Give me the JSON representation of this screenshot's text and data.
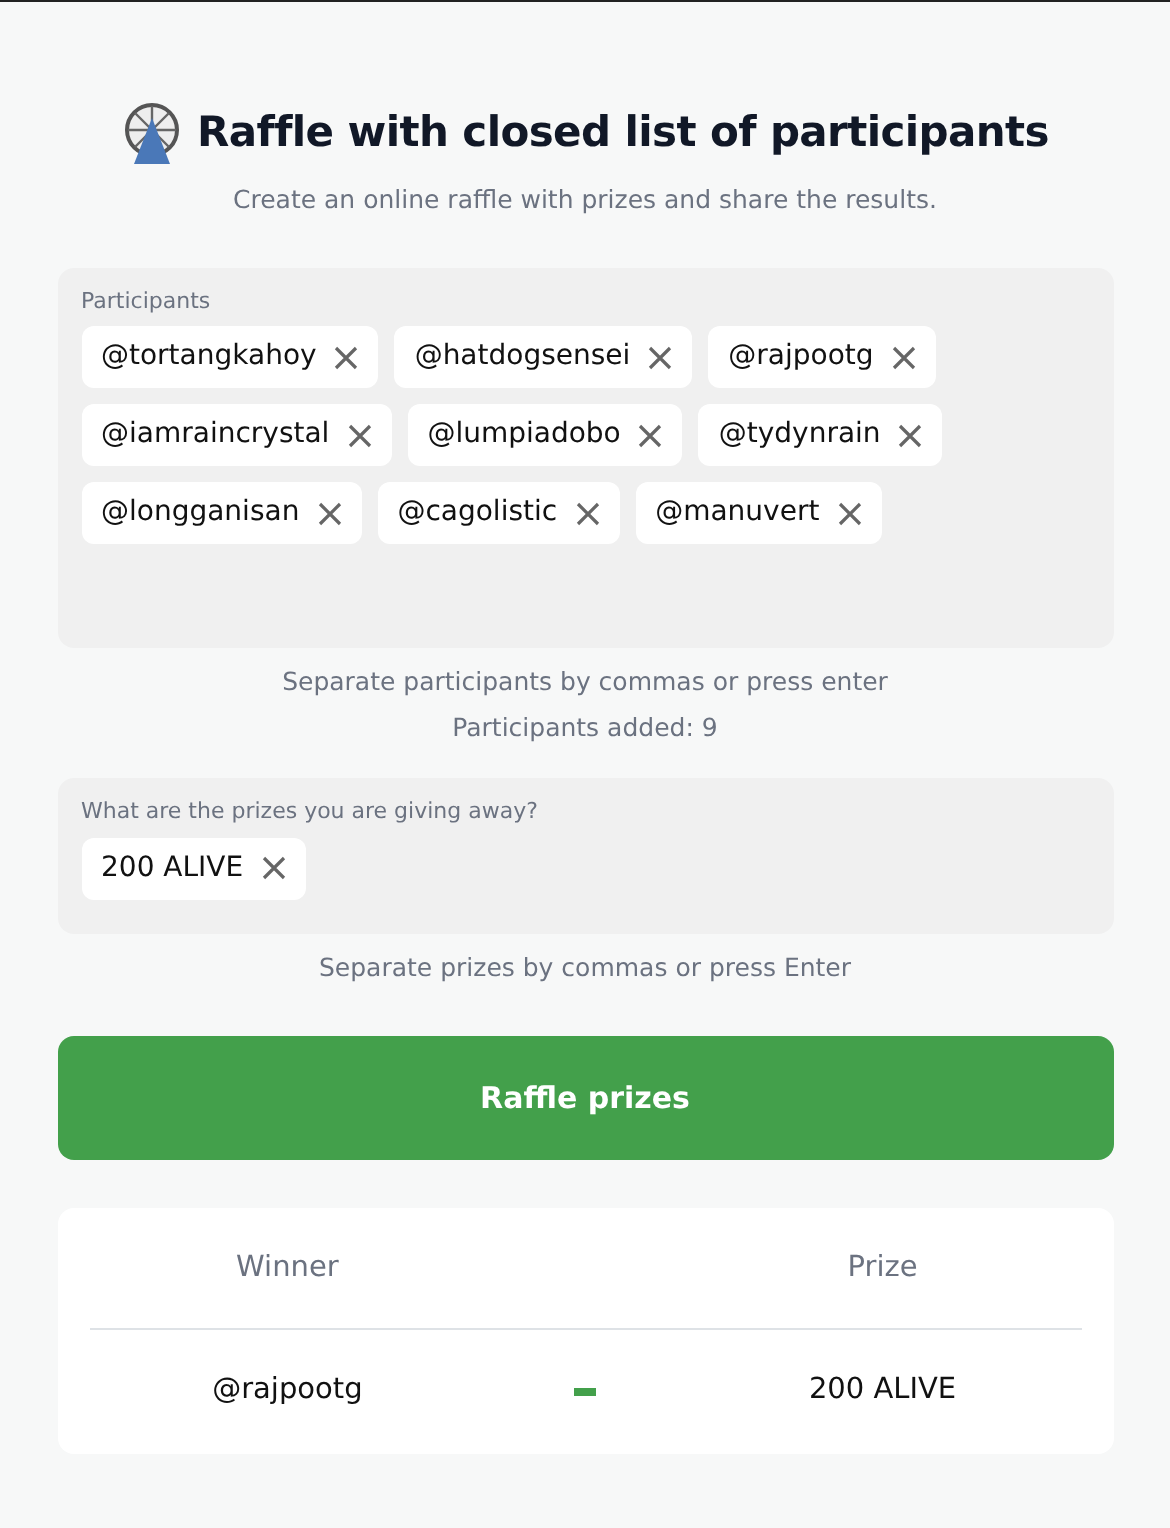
{
  "header": {
    "title": "Raffle with closed list of participants",
    "subtitle": "Create an online raffle with prizes and share the results."
  },
  "participants": {
    "label": "Participants",
    "tags": [
      "@tortangkahoy",
      "@hatdogsensei",
      "@rajpootg",
      "@iamraincrystal",
      "@lumpiadobo",
      "@tydynrain",
      "@longganisan",
      "@cagolistic",
      "@manuvert"
    ],
    "hint": "Separate participants by commas or press enter",
    "count": "Participants added: 9"
  },
  "prizes": {
    "label": "What are the prizes you are giving away?",
    "tags": [
      "200 ALIVE"
    ],
    "hint": "Separate prizes by commas or press Enter"
  },
  "raffle_button": "Raffle prizes",
  "results": {
    "columns": [
      "Winner",
      "Prize"
    ],
    "rows": [
      {
        "winner": "@rajpootg",
        "prize": "200 ALIVE"
      }
    ]
  }
}
